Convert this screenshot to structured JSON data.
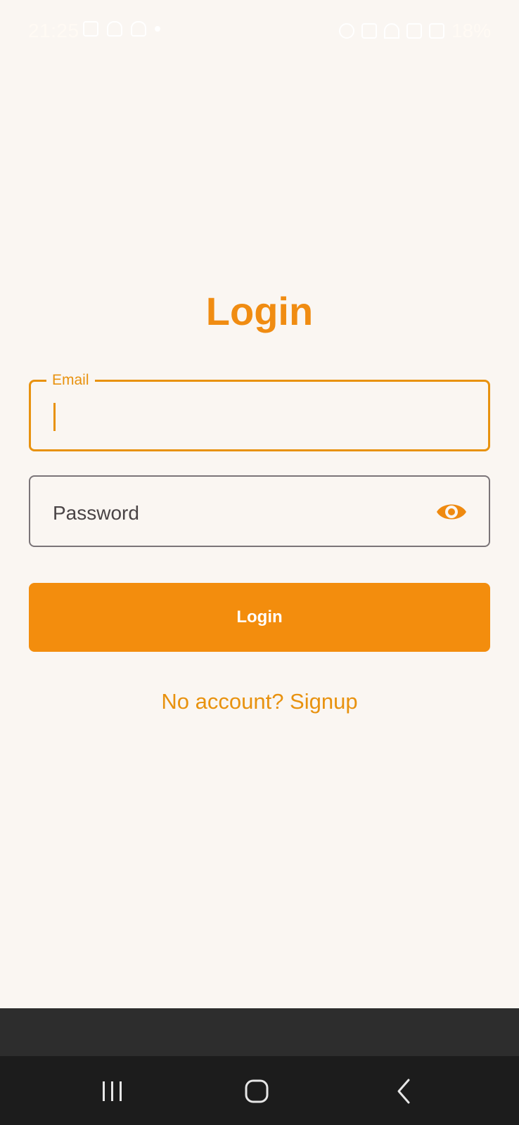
{
  "status_bar": {
    "time": "21:25",
    "battery": "18%"
  },
  "login": {
    "title": "Login",
    "email_label": "Email",
    "email_value": "",
    "password_placeholder": "Password",
    "login_button": "Login",
    "signup_link": "No account? Signup"
  },
  "colors": {
    "accent": "#f38d0d",
    "background": "#faf6f2"
  },
  "icons": {
    "password_toggle": "eye-icon",
    "nav_recent": "recent-apps-icon",
    "nav_home": "home-icon",
    "nav_back": "back-icon"
  }
}
